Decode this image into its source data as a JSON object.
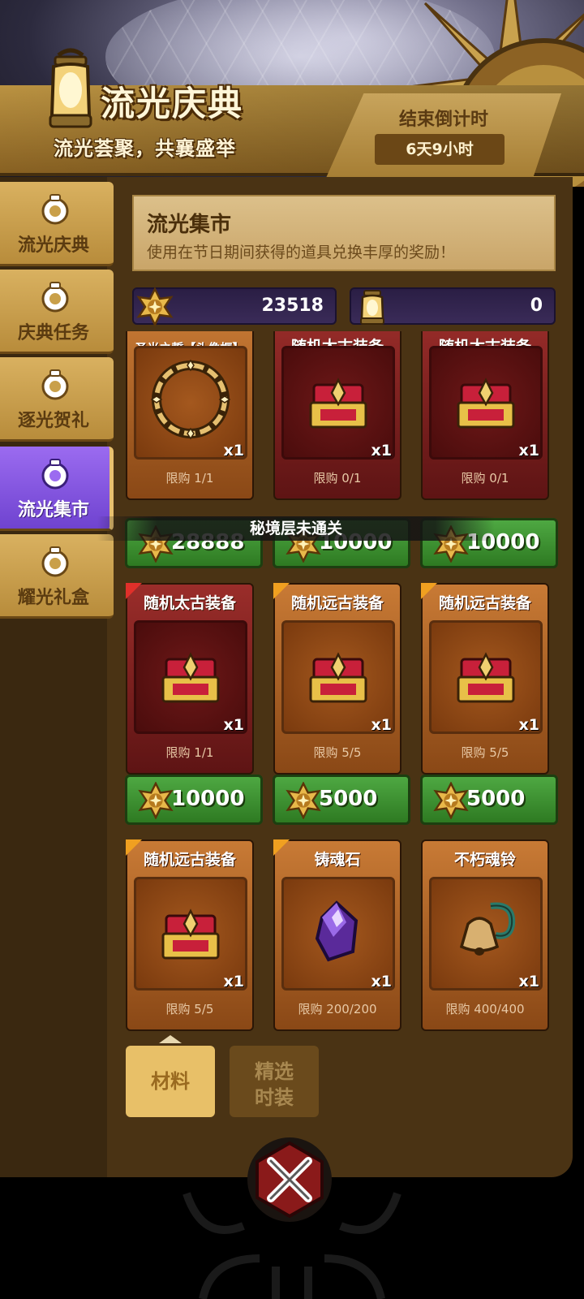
{
  "event": {
    "title": "流光庆典",
    "subtitle": "流光荟聚，共襄盛举",
    "countdown_label": "结束倒计时",
    "countdown_value": "6天9小时"
  },
  "sidebar": {
    "items": [
      {
        "label": "流光庆典",
        "active": false
      },
      {
        "label": "庆典任务",
        "active": false
      },
      {
        "label": "逐光贺礼",
        "active": false
      },
      {
        "label": "流光集市",
        "active": true
      },
      {
        "label": "耀光礼盒",
        "active": false
      }
    ]
  },
  "shop": {
    "title": "流光集市",
    "description": "使用在节日期间获得的道具兑换丰厚的奖励！"
  },
  "currency": {
    "star_coin": "23518",
    "lantern": "0"
  },
  "items": [
    {
      "name": "圣光之誓【头像框】",
      "qty": "x1",
      "limit": "限购 1/1",
      "price": "28888",
      "icon": "halo-frame-icon"
    },
    {
      "name": "随机太古装备",
      "qty": "x1",
      "limit": "限购 0/1",
      "price": "10000",
      "icon": "treasure-chest-icon"
    },
    {
      "name": "随机太古装备",
      "qty": "x1",
      "limit": "限购 0/1",
      "price": "10000",
      "icon": "treasure-chest-icon"
    },
    {
      "name": "随机太古装备",
      "qty": "x1",
      "limit": "限购 1/1",
      "price": "10000",
      "icon": "treasure-chest-icon"
    },
    {
      "name": "随机远古装备",
      "qty": "x1",
      "limit": "限购 5/5",
      "price": "5000",
      "icon": "treasure-chest-icon"
    },
    {
      "name": "随机远古装备",
      "qty": "x1",
      "limit": "限购 5/5",
      "price": "5000",
      "icon": "treasure-chest-icon"
    },
    {
      "name": "随机远古装备",
      "qty": "x1",
      "limit": "限购 5/5",
      "icon": "treasure-chest-icon"
    },
    {
      "name": "铸魂石",
      "qty": "x1",
      "limit": "限购 200/200",
      "icon": "purple-crystal-icon"
    },
    {
      "name": "不朽魂铃",
      "qty": "x1",
      "limit": "限购 400/400",
      "icon": "bell-icon"
    }
  ],
  "toast": "秘境层未通关",
  "categories": {
    "materials": "材料",
    "fashion": "精选时装"
  },
  "colors": {
    "accent_gold": "#e8c068",
    "active_tab_purple": "#7b4fe0",
    "buy_green": "#3e9434"
  }
}
